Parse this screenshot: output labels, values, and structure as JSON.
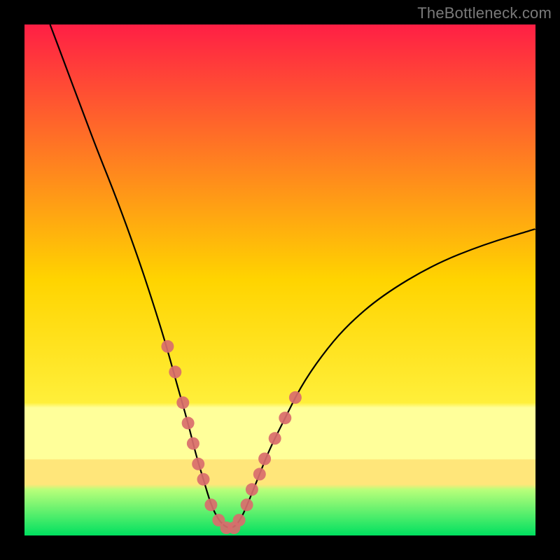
{
  "watermark": "TheBottleneck.com",
  "colors": {
    "frame": "#000000",
    "grad_top": "#ff1f45",
    "grad_mid": "#ffd400",
    "grad_band_light": "#ffff9a",
    "grad_band_dark": "#ffe67a",
    "grad_bottom": "#00e060",
    "curve": "#000000",
    "marker": "#d96d6d"
  },
  "chart_data": {
    "type": "line",
    "title": "",
    "xlabel": "",
    "ylabel": "",
    "xlim": [
      0,
      100
    ],
    "ylim": [
      0,
      100
    ],
    "series": [
      {
        "name": "curve",
        "x": [
          5,
          8,
          11,
          14,
          18,
          22,
          25,
          27.5,
          30,
          32,
          33.5,
          35,
          36.5,
          38,
          39.5,
          41,
          42.5,
          44,
          46,
          48,
          51,
          54,
          58,
          63,
          70,
          80,
          90,
          100
        ],
        "y": [
          100,
          92,
          84,
          76,
          66,
          55,
          46,
          38,
          29,
          22,
          16,
          11,
          6,
          3,
          1.5,
          1.5,
          3.5,
          7,
          12,
          17,
          23,
          29,
          35,
          41,
          47,
          53,
          57,
          60
        ]
      }
    ],
    "markers": {
      "name": "highlighted-points",
      "x": [
        28,
        29.5,
        31,
        32,
        33,
        34,
        35,
        36.5,
        38,
        39.5,
        41,
        42,
        43.5,
        44.5,
        46,
        47,
        49,
        51,
        53
      ],
      "y": [
        37,
        32,
        26,
        22,
        18,
        14,
        11,
        6,
        3,
        1.5,
        1.5,
        3,
        6,
        9,
        12,
        15,
        19,
        23,
        27
      ]
    }
  }
}
